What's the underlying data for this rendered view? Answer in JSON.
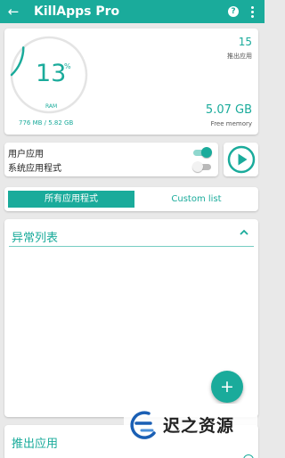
{
  "app": {
    "title": "KillApps Pro",
    "accent_color": "#1aab9b",
    "back_icon": "arrow-left-icon",
    "help_icon": "help-circle-icon",
    "more_icon": "more-vertical-icon"
  },
  "ram_card": {
    "usage_percent_value": "13",
    "percent_sign": "%",
    "ram_label": "RAM",
    "used_total": "776 MB / 5.82 GB",
    "usage_fraction": 0.13,
    "killed_count": "15",
    "killed_count_label": "推出应用",
    "free_memory_value": "5.07 GB",
    "free_memory_label": "Free memory"
  },
  "toggles": {
    "user_apps": {
      "label": "用户应用",
      "on": true
    },
    "system_apps": {
      "label": "系统应用程式",
      "on": false
    }
  },
  "play_button": {
    "icon": "play-circle-icon"
  },
  "tabs": {
    "all_apps": "所有应用程式",
    "custom_list": "Custom list"
  },
  "anomaly_list": {
    "title": "异常列表",
    "chevron_icon": "chevron-up-icon"
  },
  "fab": {
    "label": "+",
    "icon": "add-icon"
  },
  "killed_section": {
    "title": "推出应用"
  },
  "watermark": {
    "text": "迟之资源",
    "logo": "watermark-logo"
  }
}
